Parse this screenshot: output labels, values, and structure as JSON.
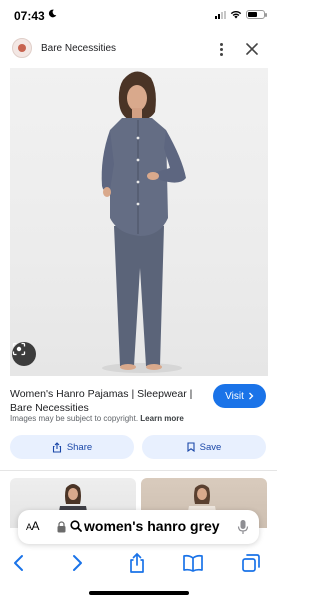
{
  "status_bar": {
    "time": "07:43",
    "battery_level": 0.6
  },
  "header": {
    "site_name": "Bare Necessities",
    "icons": [
      "site-logo",
      "more-vertical-icon",
      "close-icon"
    ]
  },
  "result": {
    "title": "Women's Hanro Pajamas | Sleepwear | Bare Necessities",
    "visit_label": "Visit",
    "copyright_text": "Images may be subject to copyright.",
    "learn_more_label": "Learn more",
    "share_label": "Share",
    "save_label": "Save"
  },
  "address_bar": {
    "aa_label": "AA",
    "query": "women's hanro grey"
  },
  "colors": {
    "accent": "#1a73e8",
    "pill_bg": "#e8f0fe",
    "pajama": "#5f6880"
  }
}
